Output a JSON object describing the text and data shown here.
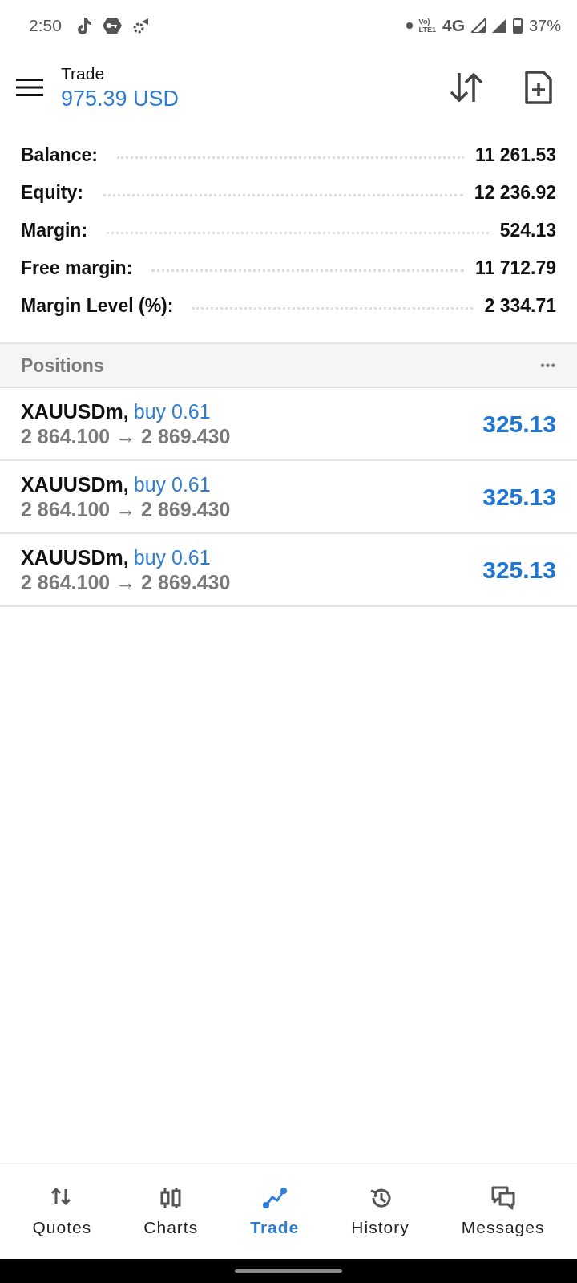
{
  "status_bar": {
    "time": "2:50",
    "volte_top": "Vo)",
    "volte_bottom": "LTE1",
    "network": "4G",
    "battery": "37%"
  },
  "header": {
    "title": "Trade",
    "amount": "975.39 USD"
  },
  "summary": [
    {
      "label": "Balance:",
      "value": "11 261.53"
    },
    {
      "label": "Equity:",
      "value": "12 236.92"
    },
    {
      "label": "Margin:",
      "value": "524.13"
    },
    {
      "label": "Free margin:",
      "value": "11 712.79"
    },
    {
      "label": "Margin Level (%):",
      "value": "2 334.71"
    }
  ],
  "positions": {
    "title": "Positions",
    "menu": "•••",
    "rows": [
      {
        "symbol": "XAUUSDm,",
        "side": "buy 0.61",
        "prices": "2 864.100 → 2 869.430",
        "profit": "325.13"
      },
      {
        "symbol": "XAUUSDm,",
        "side": "buy 0.61",
        "prices": "2 864.100 → 2 869.430",
        "profit": "325.13"
      },
      {
        "symbol": "XAUUSDm,",
        "side": "buy 0.61",
        "prices": "2 864.100 → 2 869.430",
        "profit": "325.13"
      }
    ]
  },
  "bottom_nav": [
    {
      "label": "Quotes",
      "kind": "quotes",
      "selected": false
    },
    {
      "label": "Charts",
      "kind": "charts",
      "selected": false
    },
    {
      "label": "Trade",
      "kind": "trade",
      "selected": true
    },
    {
      "label": "History",
      "kind": "history",
      "selected": false
    },
    {
      "label": "Messages",
      "kind": "messages",
      "selected": false
    }
  ]
}
